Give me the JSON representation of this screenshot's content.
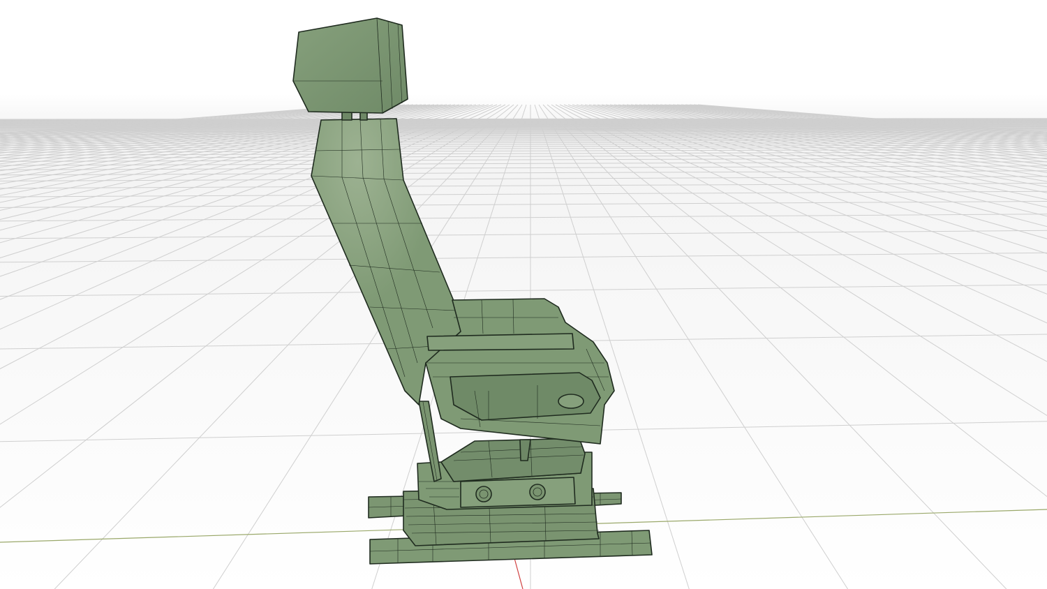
{
  "viewport": {
    "background_color": "#ffffff",
    "horizon_color": "#f4f4f4",
    "grid_color": "#cfcfcf",
    "x_axis_color": "#9aa86a",
    "y_axis_color": "#d04040",
    "view_direction": "side"
  },
  "model": {
    "object": "seat",
    "display_mode": "shaded-wireframe",
    "fill_color": "#7f9a75",
    "shadow_color": "#6e8866",
    "highlight_color": "#9bb290",
    "edge_color": "#1f2b1f"
  }
}
